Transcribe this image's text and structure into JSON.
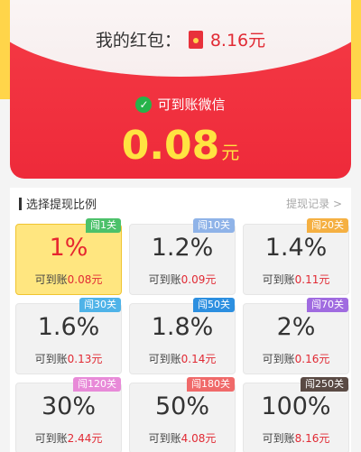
{
  "header": {
    "my_hongbao_label": "我的红包：",
    "hongbao_amount": "8.16元",
    "wechat_label": "可到账微信",
    "big_amount": "0.08",
    "big_unit": "元"
  },
  "section": {
    "title": "选择提现比例",
    "record_link": "提现记录 >"
  },
  "arrive_label": "可到账",
  "options": [
    {
      "pct": "1%",
      "amount": "0.08元",
      "tag": "闯1关",
      "tag_color": "#4cc16a",
      "selected": true
    },
    {
      "pct": "1.2%",
      "amount": "0.09元",
      "tag": "闯10关",
      "tag_color": "#8fb3e8",
      "selected": false
    },
    {
      "pct": "1.4%",
      "amount": "0.11元",
      "tag": "闯20关",
      "tag_color": "#f5b042",
      "selected": false
    },
    {
      "pct": "1.6%",
      "amount": "0.13元",
      "tag": "闯30关",
      "tag_color": "#4fb3e8",
      "selected": false
    },
    {
      "pct": "1.8%",
      "amount": "0.14元",
      "tag": "闯50关",
      "tag_color": "#2c8fe0",
      "selected": false
    },
    {
      "pct": "2%",
      "amount": "0.16元",
      "tag": "闯70关",
      "tag_color": "#a06be0",
      "selected": false
    },
    {
      "pct": "30%",
      "amount": "2.44元",
      "tag": "闯120关",
      "tag_color": "#e88ad8",
      "selected": false
    },
    {
      "pct": "50%",
      "amount": "4.08元",
      "tag": "闯180关",
      "tag_color": "#f06a6a",
      "selected": false
    },
    {
      "pct": "100%",
      "amount": "8.16元",
      "tag": "闯250关",
      "tag_color": "#5a4a44",
      "selected": false
    }
  ],
  "colors": {
    "red": "#ee2a3a",
    "yellow": "#ffe341",
    "selected_bg": "#ffe680"
  }
}
